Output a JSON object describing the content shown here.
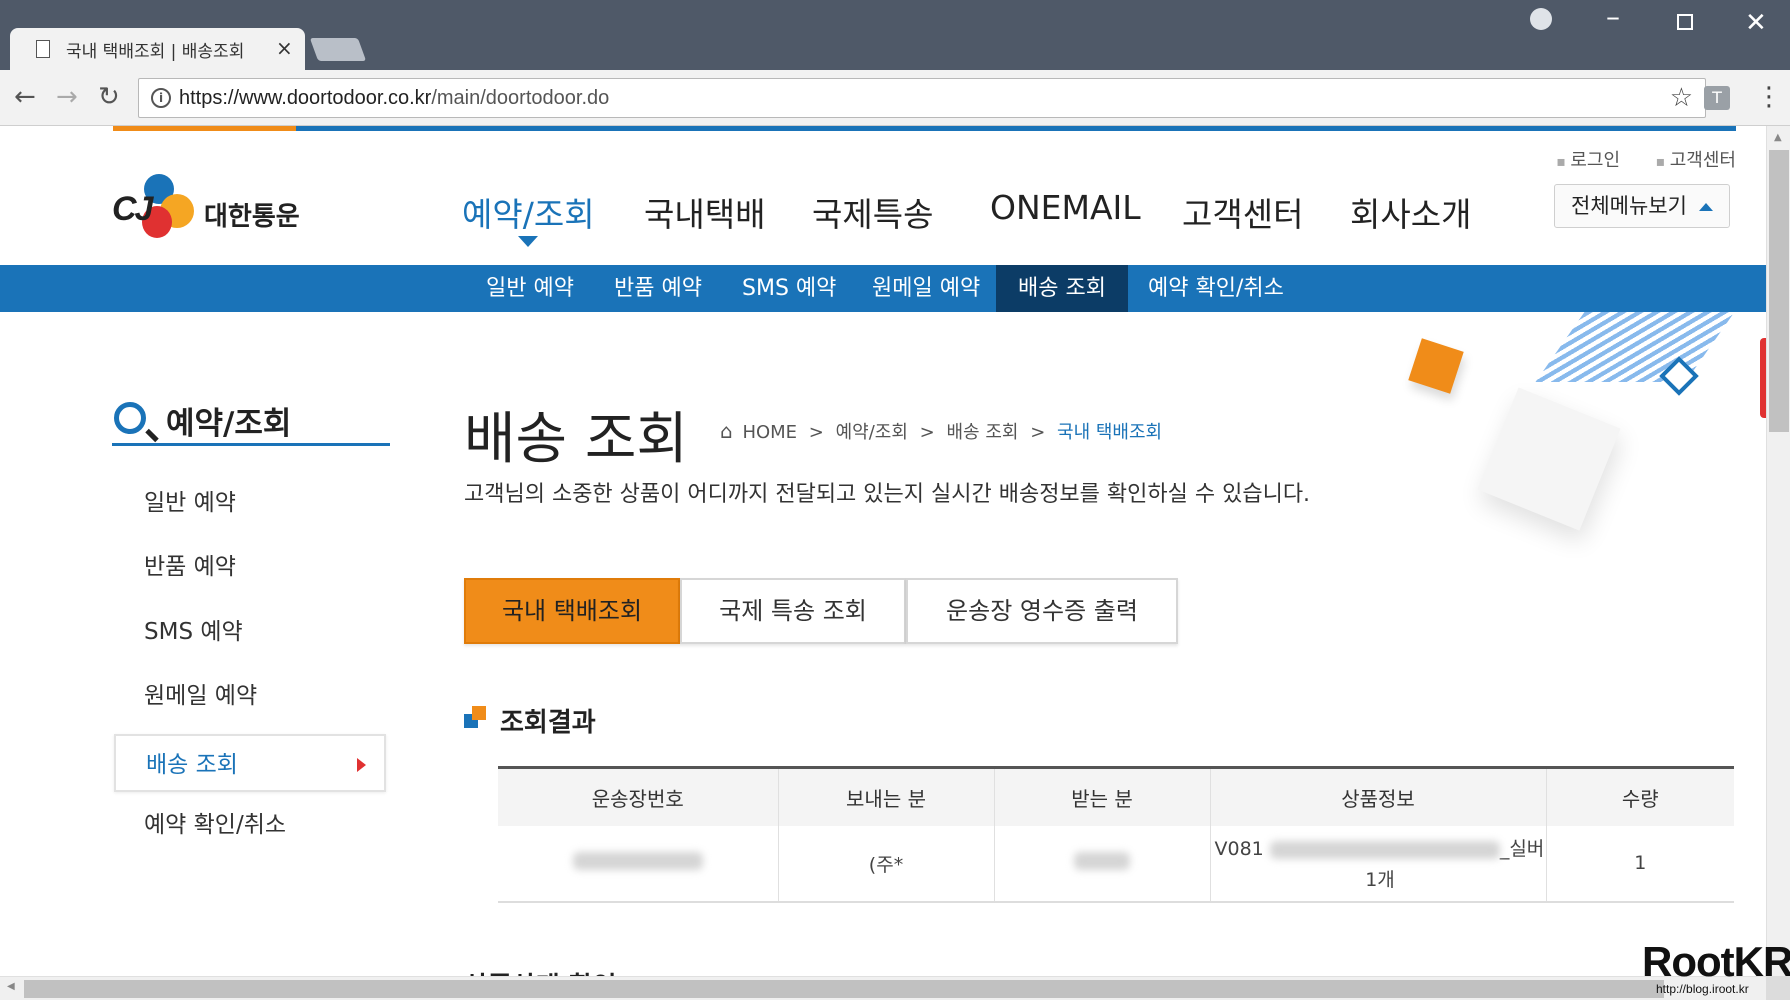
{
  "browser": {
    "tab_title": "국내 택배조회 | 배송조회",
    "url_host": "https://www.doortodoor.co.kr",
    "url_path": "/main/doortodoor.do",
    "ext_label": "T"
  },
  "site": {
    "logo_cj": "CJ",
    "logo_name": "대한통운",
    "util_links": [
      "로그인",
      "고객센터"
    ],
    "gnb": [
      "예약/조회",
      "국내택배",
      "국제특송",
      "ONEMAIL",
      "고객센터",
      "회사소개"
    ],
    "gnb_active": "예약/조회",
    "allmenu_label": "전체메뉴보기",
    "subnav": [
      "일반 예약",
      "반품 예약",
      "SMS 예약",
      "원메일 예약",
      "배송 조회",
      "예약 확인/취소"
    ],
    "subnav_active": "배송 조회"
  },
  "sidebar": {
    "title": "예약/조회",
    "items": [
      "일반 예약",
      "반품 예약",
      "SMS 예약",
      "원메일 예약",
      "배송 조회",
      "예약 확인/취소"
    ],
    "active": "배송 조회"
  },
  "main": {
    "title": "배송 조회",
    "breadcrumb": [
      "HOME",
      "예약/조회",
      "배송 조회",
      "국내 택배조회"
    ],
    "description": "고객님의 소중한 상품이 어디까지 전달되고 있는지 실시간 배송정보를 확인하실 수 있습니다.",
    "tabs": [
      "국내 택배조회",
      "국제 특송 조회",
      "운송장 영수증 출력"
    ],
    "active_tab": "국내 택배조회",
    "result_title": "조회결과",
    "table": {
      "headers": [
        "운송장번호",
        "보내는 분",
        "받는 분",
        "상품정보",
        "수량"
      ],
      "row": {
        "tracking": "",
        "sender": "(주*",
        "receiver": "",
        "product_prefix": "V081",
        "product_suffix": "_실버",
        "product_qty_line": "1개",
        "qty": "1"
      }
    },
    "next_section_title": "상품상태 확인"
  },
  "watermark": {
    "brand": "RootKR",
    "url": "http://blog.iroot.kr"
  },
  "colors": {
    "brand_blue": "#1a73b8",
    "brand_orange": "#f08c19",
    "subnav_active": "#0c3c66"
  }
}
